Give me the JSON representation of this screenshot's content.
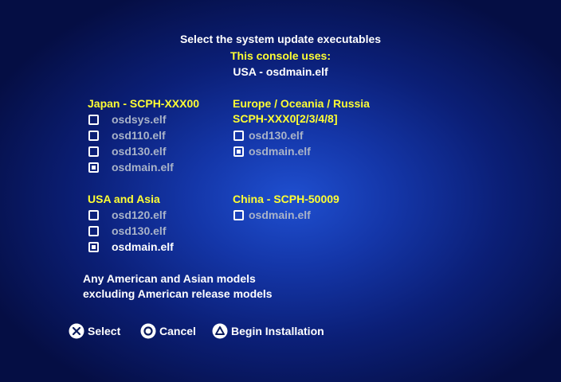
{
  "header": {
    "title": "Select the system update executables",
    "console_label": "This console uses:",
    "console_value": "USA - osdmain.elf"
  },
  "groups": {
    "japan": {
      "heading": "Japan - SCPH-XXX00",
      "items": [
        {
          "label": "osdsys.elf",
          "checked": false
        },
        {
          "label": "osd110.elf",
          "checked": false
        },
        {
          "label": "osd130.elf",
          "checked": false
        },
        {
          "label": "osdmain.elf",
          "checked": true
        }
      ]
    },
    "europe": {
      "heading_line1": "Europe / Oceania / Russia",
      "heading_line2": "SCPH-XXX0[2/3/4/8]",
      "items": [
        {
          "label": "osd130.elf",
          "checked": false
        },
        {
          "label": "osdmain.elf",
          "checked": true
        }
      ]
    },
    "usa_asia": {
      "heading": "USA and Asia",
      "items": [
        {
          "label": "osd120.elf",
          "checked": false
        },
        {
          "label": "osd130.elf",
          "checked": false
        },
        {
          "label": "osdmain.elf",
          "checked": true,
          "selected": true
        }
      ]
    },
    "china": {
      "heading": "China - SCPH-50009",
      "items": [
        {
          "label": "osdmain.elf",
          "checked": false
        }
      ]
    }
  },
  "description": {
    "line1": "Any American and Asian models",
    "line2": "excluding American release models"
  },
  "buttons": {
    "select": {
      "icon": "cross-icon",
      "label": "Select"
    },
    "cancel": {
      "icon": "circle-icon",
      "label": "Cancel"
    },
    "install": {
      "icon": "triangle-icon",
      "label": "Begin Installation"
    }
  }
}
